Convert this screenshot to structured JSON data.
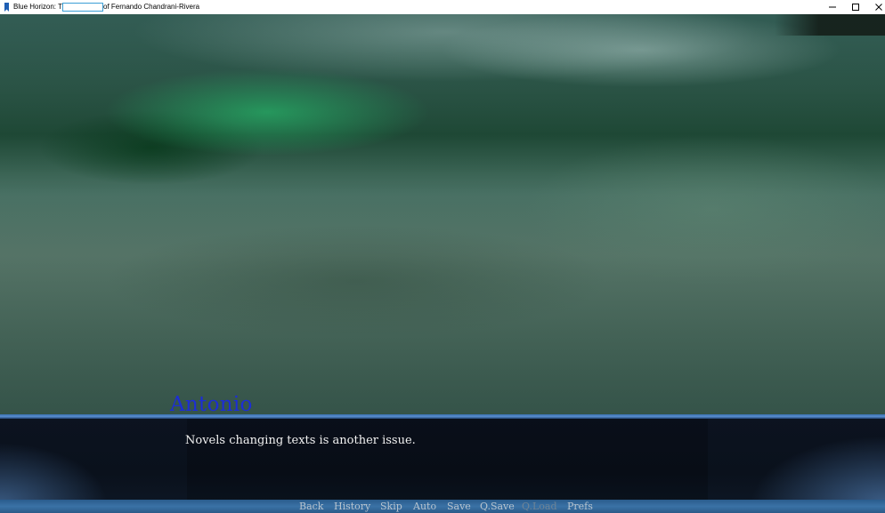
{
  "window": {
    "title_prefix": "Blue Horizon: The",
    "title_suffix": "of Fernando Chandrani-Rivera",
    "controls": {
      "minimize": "minimize-icon",
      "maximize": "maximize-icon",
      "close": "close-icon"
    }
  },
  "dialogue": {
    "speaker": "Antonio",
    "speaker_color": "#1c2dd6",
    "text": "Novels changing texts is another issue."
  },
  "quick_menu": {
    "items": [
      {
        "label": "Back",
        "enabled": true
      },
      {
        "label": "History",
        "enabled": true
      },
      {
        "label": "Skip",
        "enabled": true
      },
      {
        "label": "Auto",
        "enabled": true
      },
      {
        "label": "Save",
        "enabled": true
      },
      {
        "label": "Q.Save",
        "enabled": true
      },
      {
        "label": "Q.Load",
        "enabled": false
      },
      {
        "label": "Prefs",
        "enabled": true
      }
    ]
  },
  "colors": {
    "accent": "#3a72a6",
    "menu_text": "#b8c4cf",
    "menu_text_disabled": "#6f8496"
  }
}
